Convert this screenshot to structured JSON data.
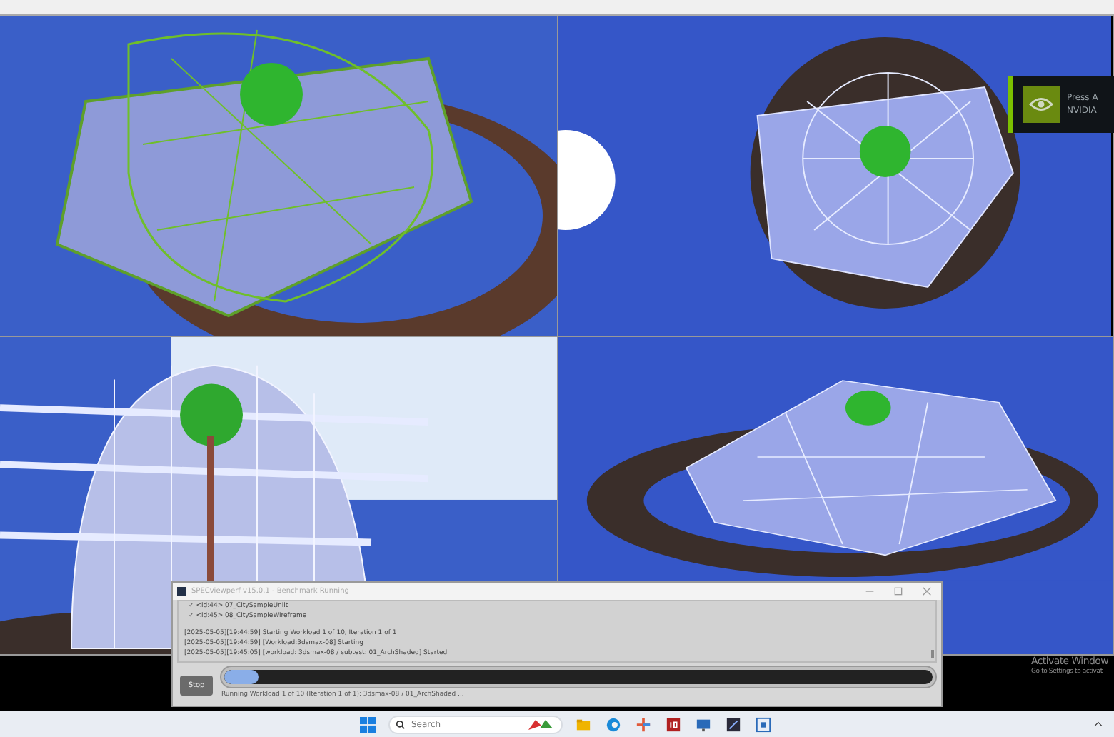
{
  "notification": {
    "line_1": "Press A",
    "line_2": "NVIDIA"
  },
  "dialog": {
    "title": "SPECviewperf v15.0.1 - Benchmark Running",
    "log": [
      {
        "text": "✓ <id:44> 07_CitySampleUnlit",
        "kind": "check"
      },
      {
        "text": "✓ <id:45> 08_CitySampleWireframe",
        "kind": "check"
      },
      {
        "text": "[2025-05-05][19:44:59] Starting Workload 1 of 10, Iteration 1 of 1",
        "kind": "entry",
        "gap_before": true
      },
      {
        "text": "[2025-05-05][19:44:59] [Workload:3dsmax-08] Starting",
        "kind": "entry"
      },
      {
        "text": "[2025-05-05][19:45:05] [workload: 3dsmax-08 / subtest: 01_ArchShaded] Started",
        "kind": "entry"
      }
    ],
    "stop_button": "Stop",
    "progress": {
      "level": 0.02
    },
    "status": "Running Workload 1 of 10 (Iteration 1 of 1): 3dsmax-08 / 01_ArchShaded ..."
  },
  "activation": {
    "title": "Activate Window",
    "subtitle": "Go to Settings to activat"
  },
  "taskbar": {
    "search": {
      "placeholder": "Search"
    }
  }
}
